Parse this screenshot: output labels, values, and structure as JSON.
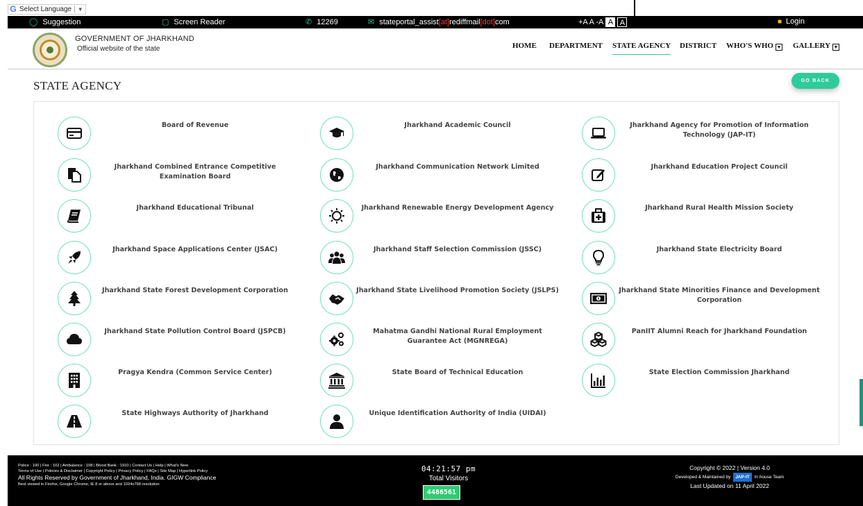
{
  "translate": {
    "label": "Select Language",
    "arrow": "▼"
  },
  "topbar": {
    "suggestion": "Suggestion",
    "screen_reader": "Screen Reader",
    "phone": "12269",
    "email_pre": "stateportal_assist",
    "email_at": "[at]",
    "email_mid": "rediffmail",
    "email_dot": "[dot]",
    "email_post": "com",
    "font_controls": "+A A -A",
    "contrast_light": "A",
    "contrast_dark": "A",
    "login": "Login"
  },
  "header": {
    "title": "GOVERNMENT OF JHARKHAND",
    "subtitle": "Official website of the state",
    "nav": [
      {
        "label": "HOME"
      },
      {
        "label": "DEPARTMENT"
      },
      {
        "label": "STATE AGENCY"
      },
      {
        "label": "DISTRICT"
      },
      {
        "label": "WHO'S WHO"
      },
      {
        "label": "GALLERY"
      }
    ]
  },
  "page": {
    "title": "STATE AGENCY",
    "go_back": "GO BACK"
  },
  "agencies": [
    {
      "name": "Board of Revenue",
      "icon": "credit-card-icon"
    },
    {
      "name": "Jharkhand Academic Council",
      "icon": "graduation-cap-icon"
    },
    {
      "name": "Jharkhand Agency for Promotion of Information Technology (JAP-IT)",
      "icon": "laptop-icon"
    },
    {
      "name": "Jharkhand Combined Entrance Competitive Examination Board",
      "icon": "documents-icon"
    },
    {
      "name": "Jharkhand Communication Network Limited",
      "icon": "globe-icon"
    },
    {
      "name": "Jharkhand Education Project Council",
      "icon": "edit-icon"
    },
    {
      "name": "Jharkhand Educational Tribunal",
      "icon": "book-icon"
    },
    {
      "name": "Jharkhand Renewable Energy Development Agency",
      "icon": "sun-icon"
    },
    {
      "name": "Jharkhand Rural Health Mission Society",
      "icon": "medkit-icon"
    },
    {
      "name": "Jharkhand Space Applications Center (JSAC)",
      "icon": "rocket-icon"
    },
    {
      "name": "Jharkhand Staff Selection Commission (JSSC)",
      "icon": "users-icon"
    },
    {
      "name": "Jharkhand State Electricity Board",
      "icon": "lightbulb-icon"
    },
    {
      "name": "Jharkhand State Forest Development Corporation",
      "icon": "tree-icon"
    },
    {
      "name": "Jharkhand State Livelihood Promotion Society (JSLPS)",
      "icon": "handshake-icon"
    },
    {
      "name": "Jharkhand State Minorities Finance and Development Corporation",
      "icon": "money-bill-icon"
    },
    {
      "name": "Jharkhand State Pollution Control Board (JSPCB)",
      "icon": "cloud-icon"
    },
    {
      "name": "Mahatma Gandhi National Rural Employment Guarantee Act (MGNREGA)",
      "icon": "cogs-icon"
    },
    {
      "name": "PanIIT Alumni Reach for Jharkhand Foundation",
      "icon": "cubes-icon"
    },
    {
      "name": "Pragya Kendra (Common Service Center)",
      "icon": "building-icon"
    },
    {
      "name": "State Board of Technical Education",
      "icon": "institution-icon"
    },
    {
      "name": "State Election Commission Jharkhand",
      "icon": "bar-chart-icon"
    },
    {
      "name": "State Highways Authority of Jharkhand",
      "icon": "road-icon"
    },
    {
      "name": "Unique Identification Authority of India (UIDAI)",
      "icon": "user-icon"
    }
  ],
  "footer": {
    "links_line1": "Police : 100 | Fire : 102 | Ambulance : 108 | Blood Bank : 1910 | Contact Us | Help | What's New",
    "links_line2": "Terms of Use | Policies & Disclaimer | Copyright Policy | Privacy Policy | FAQs | Site Map | Hyperlink Policy",
    "rights": "All Rights Reserved by Government of Jharkhand, India.   GIGW Compliance",
    "best_viewed": "Best viewed in Firefox, Google Chrome, IE 8 or above and 1024x768 resolution",
    "clock": "04:21:57 pm",
    "visitors_label": "Total Visitors",
    "visitors_count": "4486561",
    "copyright": "Copyright © 2022 |   Version 4.0",
    "developed_pre": "Developed & Maintained by",
    "developed_brand": "JAP-IT",
    "developed_post": "In house Team",
    "last_updated": "Last Updated on 11 April 2022"
  }
}
